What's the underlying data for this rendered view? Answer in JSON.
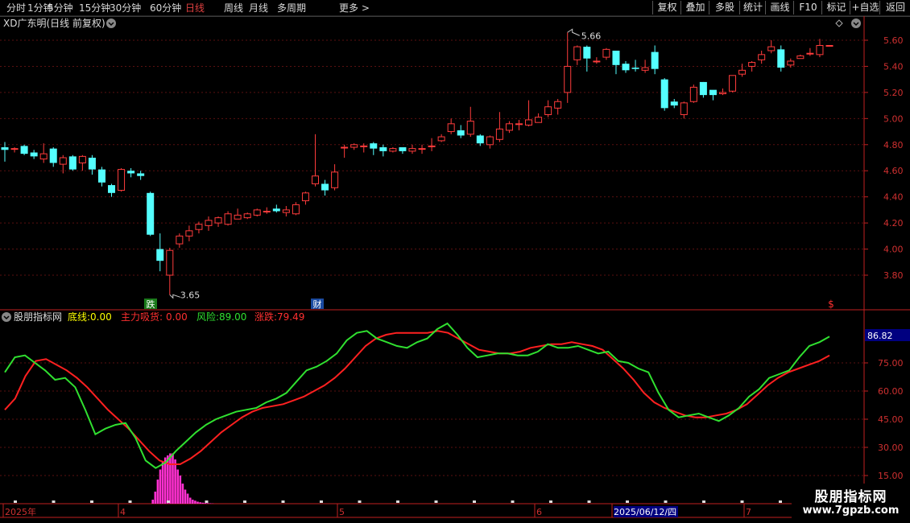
{
  "toolbar": {
    "periods": [
      "分时",
      "1分钟",
      "5分钟",
      "15分钟",
      "30分钟",
      "60分钟",
      "日线",
      "周线",
      "月线",
      "多周期",
      "更多 >"
    ],
    "active": "日线",
    "right": [
      "复权",
      "叠加",
      "多股",
      "统计",
      "画线",
      "F10",
      "标记",
      "+自选",
      "返回"
    ]
  },
  "main_panel": {
    "title": "XD广东明(日线 前复权)",
    "y_ticks": [
      "5.60",
      "5.40",
      "5.20",
      "5.00",
      "4.80",
      "4.60",
      "4.40",
      "4.20",
      "4.00",
      "3.80"
    ],
    "high_label": "5.66",
    "low_label": "3.65",
    "markers": [
      "跌",
      "财",
      "$"
    ]
  },
  "indicator_panel": {
    "name": "股朋指标网",
    "items": [
      {
        "label": "底线:",
        "value": "0.00",
        "color": "#ffff00"
      },
      {
        "label": "主力吸货:",
        "value": "0.00",
        "color": "#ff3030"
      },
      {
        "label": "风险:",
        "value": "89.00",
        "color": "#30e030"
      },
      {
        "label": "涨跌:",
        "value": "79.49",
        "color": "#ff3030"
      }
    ],
    "y_ticks": [
      "75.00",
      "60.00",
      "45.00",
      "30.00",
      "15.00"
    ],
    "current_value": "86.82"
  },
  "time_axis": {
    "labels": [
      "2025年",
      "4",
      "5",
      "6",
      "2025/06/12/四",
      "7"
    ]
  },
  "watermark": {
    "title": "股朋指标网",
    "url": "www.7gpzb.com"
  },
  "colors": {
    "up": "#ff3c3c",
    "down": "#54ffff",
    "fast_line": "#30e030",
    "slow_line": "#ff2020",
    "bars": "#ff30d0",
    "axis": "#c02020"
  },
  "chart_data": {
    "type": "candlestick",
    "candles": [
      [
        4.78,
        4.76,
        4.82,
        4.67
      ],
      [
        4.77,
        4.77,
        4.78,
        4.74
      ],
      [
        4.79,
        4.73,
        4.8,
        4.72
      ],
      [
        4.74,
        4.71,
        4.76,
        4.69
      ],
      [
        4.69,
        4.73,
        4.81,
        4.66
      ],
      [
        4.77,
        4.66,
        4.78,
        4.63
      ],
      [
        4.65,
        4.7,
        4.72,
        4.58
      ],
      [
        4.71,
        4.61,
        4.72,
        4.6
      ],
      [
        4.66,
        4.71,
        4.72,
        4.6
      ],
      [
        4.7,
        4.61,
        4.72,
        4.57
      ],
      [
        4.61,
        4.51,
        4.63,
        4.48
      ],
      [
        4.49,
        4.43,
        4.5,
        4.4
      ],
      [
        4.45,
        4.61,
        4.62,
        4.44
      ],
      [
        4.6,
        4.58,
        4.62,
        4.55
      ],
      [
        4.58,
        4.56,
        4.6,
        4.53
      ],
      [
        4.43,
        4.11,
        4.44,
        4.1
      ],
      [
        4.0,
        3.91,
        4.12,
        3.83
      ],
      [
        3.8,
        3.99,
        4.01,
        3.65
      ],
      [
        4.04,
        4.1,
        4.12,
        4.01
      ],
      [
        4.1,
        4.14,
        4.18,
        4.06
      ],
      [
        4.15,
        4.19,
        4.21,
        4.12
      ],
      [
        4.18,
        4.22,
        4.25,
        4.14
      ],
      [
        4.2,
        4.24,
        4.25,
        4.17
      ],
      [
        4.19,
        4.27,
        4.29,
        4.18
      ],
      [
        4.23,
        4.26,
        4.31,
        4.23
      ],
      [
        4.24,
        4.27,
        4.28,
        4.23
      ],
      [
        4.26,
        4.3,
        4.31,
        4.25
      ],
      [
        4.29,
        4.29,
        4.32,
        4.27
      ],
      [
        4.31,
        4.29,
        4.34,
        4.28
      ],
      [
        4.28,
        4.3,
        4.33,
        4.25
      ],
      [
        4.27,
        4.34,
        4.36,
        4.26
      ],
      [
        4.37,
        4.43,
        4.44,
        4.34
      ],
      [
        4.5,
        4.56,
        4.88,
        4.48
      ],
      [
        4.5,
        4.45,
        4.53,
        4.41
      ],
      [
        4.47,
        4.59,
        4.65,
        4.45
      ],
      [
        4.78,
        4.78,
        4.8,
        4.7
      ],
      [
        4.78,
        4.8,
        4.81,
        4.76
      ],
      [
        4.79,
        4.79,
        4.81,
        4.74
      ],
      [
        4.81,
        4.77,
        4.82,
        4.72
      ],
      [
        4.78,
        4.75,
        4.8,
        4.71
      ],
      [
        4.75,
        4.77,
        4.78,
        4.74
      ],
      [
        4.78,
        4.75,
        4.77,
        4.73
      ],
      [
        4.75,
        4.77,
        4.8,
        4.73
      ],
      [
        4.77,
        4.77,
        4.8,
        4.73
      ],
      [
        4.79,
        4.79,
        4.85,
        4.75
      ],
      [
        4.83,
        4.86,
        4.88,
        4.82
      ],
      [
        4.9,
        4.96,
        5.0,
        4.88
      ],
      [
        4.91,
        4.87,
        4.95,
        4.85
      ],
      [
        4.88,
        4.98,
        5.09,
        4.86
      ],
      [
        4.87,
        4.81,
        4.88,
        4.79
      ],
      [
        4.8,
        4.86,
        4.87,
        4.77
      ],
      [
        4.84,
        4.92,
        5.05,
        4.82
      ],
      [
        4.91,
        4.96,
        4.98,
        4.89
      ],
      [
        4.96,
        4.96,
        4.99,
        4.91
      ],
      [
        4.95,
        4.99,
        5.14,
        4.94
      ],
      [
        4.97,
        5.01,
        5.04,
        4.98
      ],
      [
        5.03,
        5.09,
        5.14,
        5.01
      ],
      [
        5.08,
        5.13,
        5.15,
        5.03
      ],
      [
        5.2,
        5.4,
        5.66,
        5.12
      ],
      [
        5.45,
        5.55,
        5.56,
        5.41
      ],
      [
        5.55,
        5.46,
        5.56,
        5.36
      ],
      [
        5.44,
        5.44,
        5.47,
        5.42
      ],
      [
        5.47,
        5.53,
        5.54,
        5.45
      ],
      [
        5.52,
        5.41,
        5.52,
        5.34
      ],
      [
        5.42,
        5.37,
        5.44,
        5.35
      ],
      [
        5.39,
        5.38,
        5.45,
        5.36
      ],
      [
        5.37,
        5.39,
        5.45,
        5.35
      ],
      [
        5.51,
        5.38,
        5.56,
        5.34
      ],
      [
        5.3,
        5.08,
        5.31,
        5.06
      ],
      [
        5.13,
        5.1,
        5.15,
        5.08
      ],
      [
        5.03,
        5.12,
        5.13,
        5.0
      ],
      [
        5.13,
        5.24,
        5.26,
        5.12
      ],
      [
        5.28,
        5.18,
        5.28,
        5.16
      ],
      [
        5.22,
        5.18,
        5.2,
        5.14
      ],
      [
        5.19,
        5.2,
        5.23,
        5.18
      ],
      [
        5.21,
        5.33,
        5.33,
        5.2
      ],
      [
        5.34,
        5.37,
        5.42,
        5.32
      ],
      [
        5.4,
        5.43,
        5.44,
        5.36
      ],
      [
        5.45,
        5.49,
        5.52,
        5.42
      ],
      [
        5.52,
        5.55,
        5.6,
        5.5
      ],
      [
        5.53,
        5.39,
        5.56,
        5.36
      ],
      [
        5.41,
        5.44,
        5.46,
        5.39
      ],
      [
        5.46,
        5.48,
        5.49,
        5.46
      ],
      [
        5.5,
        5.5,
        5.54,
        5.48
      ],
      [
        5.49,
        5.56,
        5.61,
        5.47
      ],
      [
        5.56,
        5.56,
        5.56,
        5.56
      ]
    ],
    "y_range": [
      3.65,
      5.7
    ],
    "high": 5.66,
    "low": 3.65,
    "indicator_series": [
      {
        "name": "风险",
        "values": [
          70,
          78,
          79,
          75,
          71,
          66,
          67,
          62,
          50,
          37,
          40,
          42,
          43,
          35,
          23,
          19,
          22,
          28,
          33,
          38,
          42,
          45,
          47,
          49,
          50,
          51,
          54,
          56,
          59,
          65,
          71,
          73,
          76,
          80,
          87,
          91,
          92,
          88,
          86,
          84,
          83,
          86,
          88,
          93,
          96,
          90,
          83,
          78,
          79,
          80,
          80,
          79,
          79,
          81,
          85,
          83,
          83,
          84,
          82,
          80,
          81,
          76,
          75,
          72,
          70,
          59,
          50,
          46,
          47,
          48,
          46,
          44,
          47,
          51,
          57,
          61,
          67,
          69,
          71,
          78,
          84,
          86,
          89
        ]
      },
      {
        "name": "涨跌",
        "values": [
          50,
          56,
          68,
          76,
          77,
          74,
          71,
          67,
          62,
          56,
          50,
          45,
          40,
          34,
          28,
          23,
          21,
          21,
          24,
          28,
          33,
          38,
          42,
          46,
          49,
          51,
          52,
          53,
          55,
          57,
          60,
          63,
          67,
          72,
          78,
          84,
          88,
          90,
          91,
          91,
          91,
          91,
          92,
          91,
          88,
          85,
          82,
          81,
          80,
          80,
          81,
          83,
          84,
          85,
          85,
          86,
          85,
          84,
          82,
          77,
          72,
          66,
          59,
          54,
          51,
          49,
          47,
          46,
          46,
          47,
          48,
          50,
          53,
          58,
          63,
          67,
          70,
          72,
          74,
          76,
          79
        ]
      }
    ],
    "indicator_y_range": [
      10,
      95
    ],
    "histogram": [
      0,
      0,
      0,
      0,
      2,
      6,
      12,
      17,
      21,
      23,
      24,
      25,
      25,
      22,
      17,
      14,
      10,
      7,
      5,
      3,
      2,
      1.5,
      1,
      0.7,
      0.5,
      0.4,
      0.3,
      0.2,
      0.1
    ]
  }
}
